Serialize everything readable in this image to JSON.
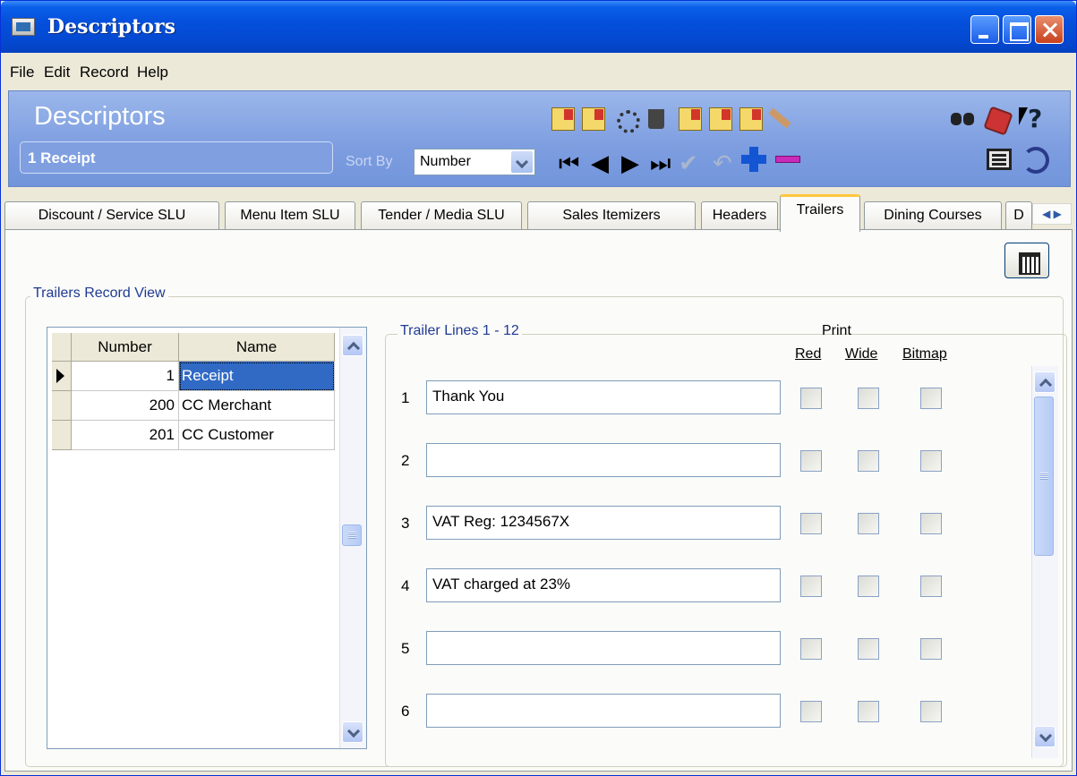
{
  "window": {
    "title": "Descriptors"
  },
  "menu": [
    "File",
    "Edit",
    "Record",
    "Help"
  ],
  "header": {
    "title": "Descriptors",
    "record": "1 Receipt",
    "sort_by_label": "Sort By",
    "sort_by_value": "Number"
  },
  "tabs": [
    {
      "label": "Discount / Service SLU",
      "active": false
    },
    {
      "label": "Menu Item SLU",
      "active": false
    },
    {
      "label": "Tender / Media SLU",
      "active": false
    },
    {
      "label": "Sales Itemizers",
      "active": false
    },
    {
      "label": "Headers",
      "active": false
    },
    {
      "label": "Trailers",
      "active": true
    },
    {
      "label": "Dining Courses",
      "active": false
    },
    {
      "label": "D",
      "active": false
    }
  ],
  "record_view": {
    "caption": "Trailers Record View",
    "columns": [
      "Number",
      "Name"
    ],
    "rows": [
      {
        "number": "1",
        "name": "Receipt",
        "selected": true
      },
      {
        "number": "200",
        "name": "CC Merchant",
        "selected": false
      },
      {
        "number": "201",
        "name": "CC Customer",
        "selected": false
      }
    ]
  },
  "trailer_lines": {
    "caption": "Trailer Lines 1 - 12",
    "print_label": "Print",
    "columns": [
      "Red",
      "Wide",
      "Bitmap"
    ],
    "lines": [
      {
        "num": "1",
        "text": "Thank You",
        "red": false,
        "wide": false,
        "bitmap": false
      },
      {
        "num": "2",
        "text": "",
        "red": false,
        "wide": false,
        "bitmap": false
      },
      {
        "num": "3",
        "text": "VAT Reg: 1234567X",
        "red": false,
        "wide": false,
        "bitmap": false
      },
      {
        "num": "4",
        "text": "VAT charged at 23%",
        "red": false,
        "wide": false,
        "bitmap": false
      },
      {
        "num": "5",
        "text": "",
        "red": false,
        "wide": false,
        "bitmap": false
      },
      {
        "num": "6",
        "text": "",
        "red": false,
        "wide": false,
        "bitmap": false
      }
    ]
  },
  "toolbar_icons": [
    "new-record-icon",
    "copy-record-icon",
    "settings-icon",
    "delete-icon",
    "edit-record-icon",
    "paste-record-icon",
    "report-icon",
    "pen-icon",
    "search-icon",
    "book-icon",
    "help-icon",
    "first-record-icon",
    "previous-record-icon",
    "next-record-icon",
    "last-record-icon",
    "confirm-icon",
    "undo-icon",
    "add-icon",
    "remove-icon",
    "monitor-icon",
    "sync-icon",
    "calendar-icon"
  ],
  "colors": {
    "titlebar": "#0450dc",
    "header_band": "#7d9de0",
    "selection": "#316ac5",
    "tab_highlight": "#ffc83c"
  }
}
